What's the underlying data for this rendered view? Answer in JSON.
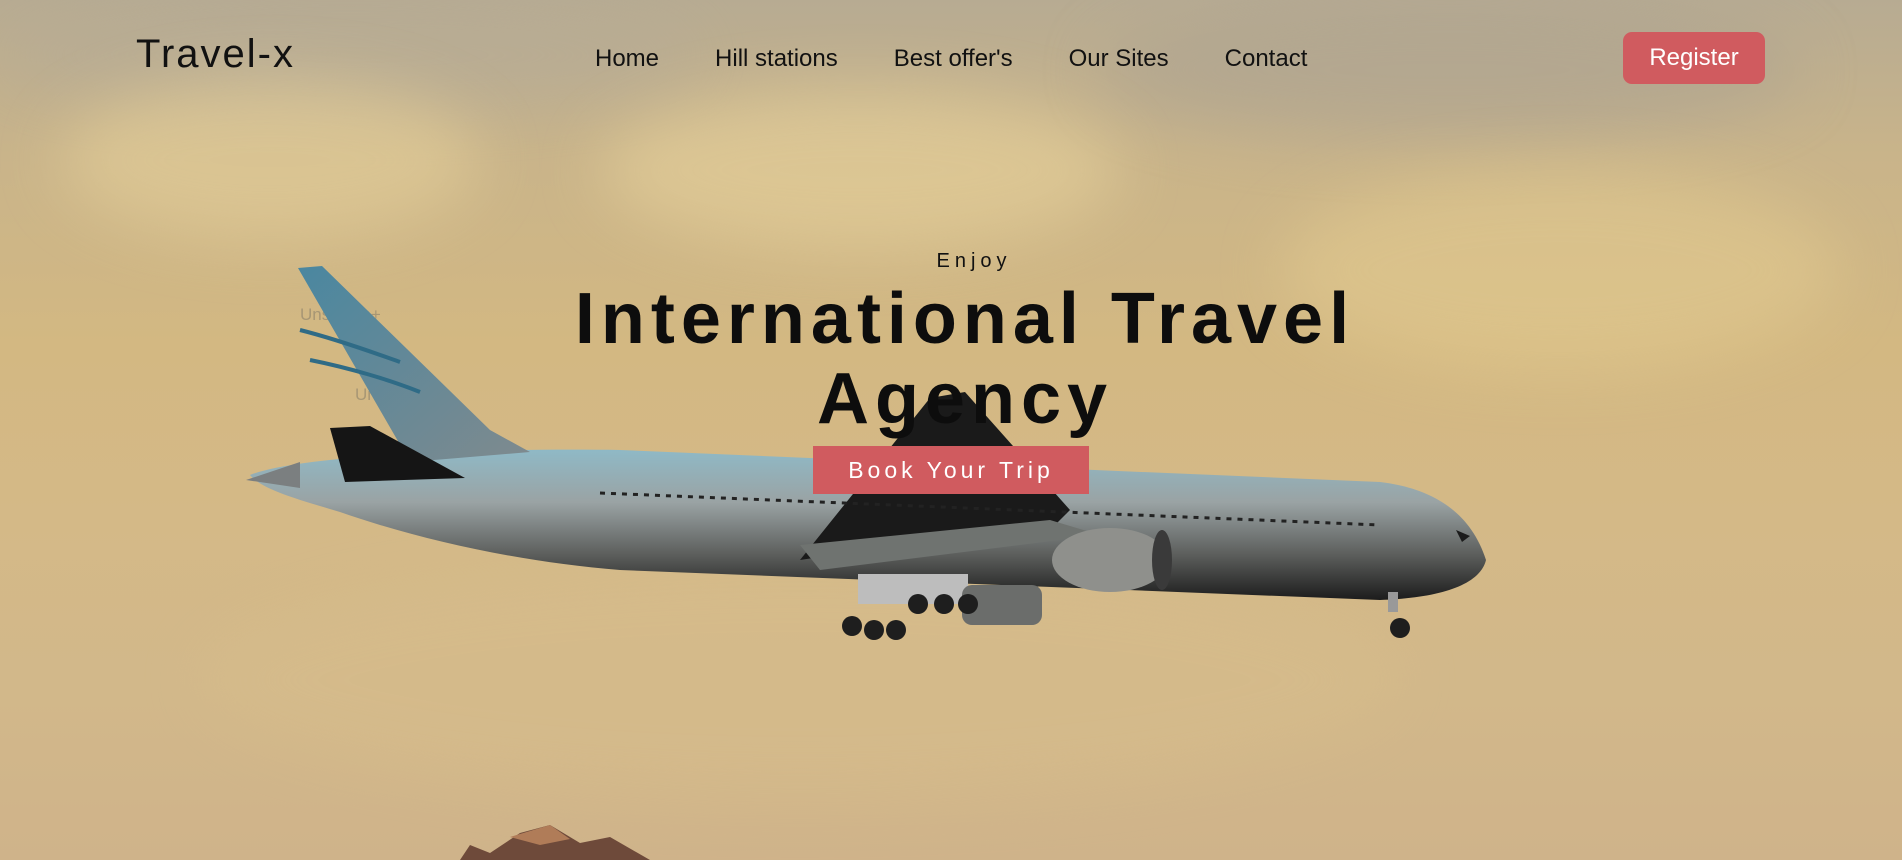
{
  "navbar": {
    "logo": "Travel-x",
    "links": [
      "Home",
      "Hill stations",
      "Best offer's",
      "Our Sites",
      "Contact"
    ],
    "register_label": "Register"
  },
  "hero": {
    "kicker": "Enjoy",
    "title": "International Travel Agency",
    "book_label": "Book Your Trip",
    "background_image_watermark": "Unsplash+"
  },
  "colors": {
    "accent": "#d05b5f",
    "text": "#111111",
    "sky": "#d3b882"
  },
  "icons": [
    "airplane-image",
    "mountain-peak-image"
  ]
}
